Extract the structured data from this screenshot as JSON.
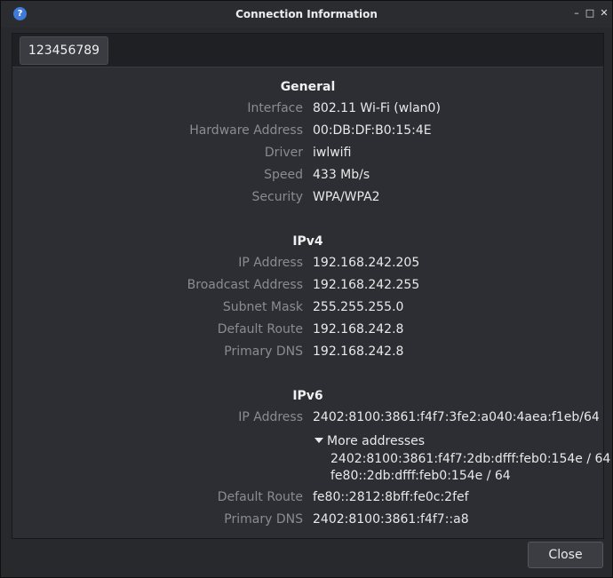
{
  "window": {
    "title": "Connection Information",
    "help_glyph": "?",
    "minimize_glyph": "–",
    "maximize_glyph": "□",
    "close_glyph": "✕"
  },
  "tab": {
    "label": "123456789"
  },
  "general": {
    "title": "General",
    "rows": [
      {
        "label": "Interface",
        "value": "802.11 Wi-Fi (wlan0)"
      },
      {
        "label": "Hardware Address",
        "value": "00:DB:DF:B0:15:4E"
      },
      {
        "label": "Driver",
        "value": "iwlwifi"
      },
      {
        "label": "Speed",
        "value": "433 Mb/s"
      },
      {
        "label": "Security",
        "value": "WPA/WPA2"
      }
    ]
  },
  "ipv4": {
    "title": "IPv4",
    "rows": [
      {
        "label": "IP Address",
        "value": "192.168.242.205"
      },
      {
        "label": "Broadcast Address",
        "value": "192.168.242.255"
      },
      {
        "label": "Subnet Mask",
        "value": "255.255.255.0"
      },
      {
        "label": "Default Route",
        "value": "192.168.242.8"
      },
      {
        "label": "Primary DNS",
        "value": "192.168.242.8"
      }
    ]
  },
  "ipv6": {
    "title": "IPv6",
    "ip_label": "IP Address",
    "ip_value": "2402:8100:3861:f4f7:3fe2:a040:4aea:f1eb/64",
    "more_label": "More addresses",
    "more_addresses": [
      "2402:8100:3861:f4f7:2db:dfff:feb0:154e / 64",
      "fe80::2db:dfff:feb0:154e / 64"
    ],
    "route_label": "Default Route",
    "route_value": "fe80::2812:8bff:fe0c:2fef",
    "dns_label": "Primary DNS",
    "dns_value": "2402:8100:3861:f4f7::a8"
  },
  "footer": {
    "close_label": "Close"
  }
}
